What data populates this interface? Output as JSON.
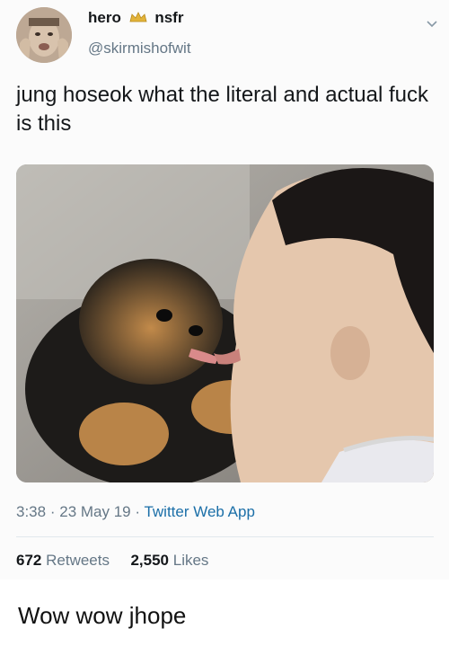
{
  "tweet": {
    "display_name_part1": "hero",
    "display_name_part2": "nsfr",
    "handle": "@skirmishofwit",
    "text": "jung hoseok what the literal and actual fuck is this",
    "time": "3:38",
    "date": "23 May 19",
    "source": "Twitter Web App",
    "retweets_count": "672",
    "retweets_label": "Retweets",
    "likes_count": "2,550",
    "likes_label": "Likes",
    "sep": "·"
  },
  "caption": "Wow wow jhope",
  "icons": {
    "verified": "crown-icon",
    "menu": "chevron-down-icon"
  },
  "colors": {
    "link": "#1b6fa8",
    "muted": "#657786",
    "text": "#14171a"
  }
}
